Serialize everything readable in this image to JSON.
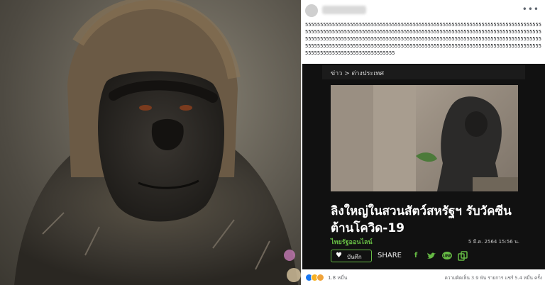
{
  "post": {
    "text": "5555555555555555555555555555555555555555555555555555555555555555555555555555555555555555555555555555555555555555555555555555555555555555555555555555555555555555555555555555555555555555555555555555555555555555555555555555555555555555555555555555555555555555555555555555555555555555555555555555555555555555555555555555555555555555555555555555555555",
    "more": "•••"
  },
  "article": {
    "breadcrumb": "ข่าว > ต่างประเทศ",
    "headline": "ลิงใหญ่ในสวนสัตว์สหรัฐฯ รับวัคซีนต้านโควิด-19",
    "source": "ไทยรัฐออนไลน์",
    "date": "5 มี.ค. 2564 15:56 น.",
    "save_label": "บันทึก",
    "share_label": "SHARE"
  },
  "footer": {
    "reaction_count": "1.8 หมื่น",
    "stats": "ความคิดเห็น 3.9 พัน รายการ  แชร์ 5.4 หมื่น ครั้ง"
  },
  "colors": {
    "accent_green": "#66bb44",
    "facebook_blue": "#1877f2"
  },
  "icons": [
    "heart-icon",
    "facebook-icon",
    "twitter-icon",
    "line-icon",
    "copy-link-icon"
  ]
}
